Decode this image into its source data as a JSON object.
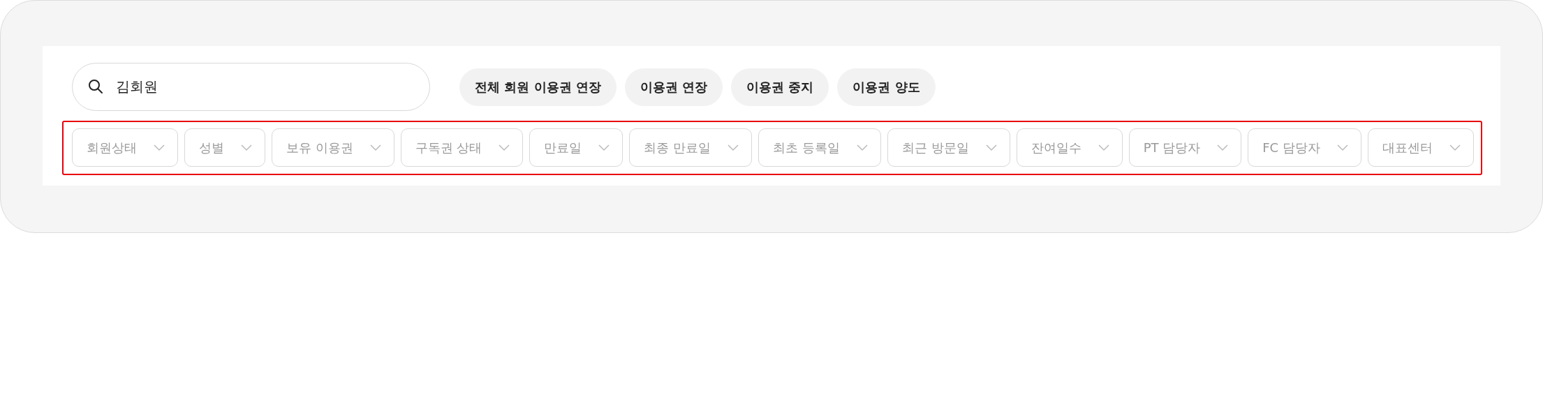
{
  "search": {
    "value": "김회원"
  },
  "actions": [
    "전체 회원 이용권 연장",
    "이용권 연장",
    "이용권 중지",
    "이용권 양도"
  ],
  "filters": [
    "회원상태",
    "성별",
    "보유 이용권",
    "구독권 상태",
    "만료일",
    "최종 만료일",
    "최초 등록일",
    "최근 방문일",
    "잔여일수",
    "PT 담당자",
    "FC 담당자",
    "대표센터"
  ]
}
